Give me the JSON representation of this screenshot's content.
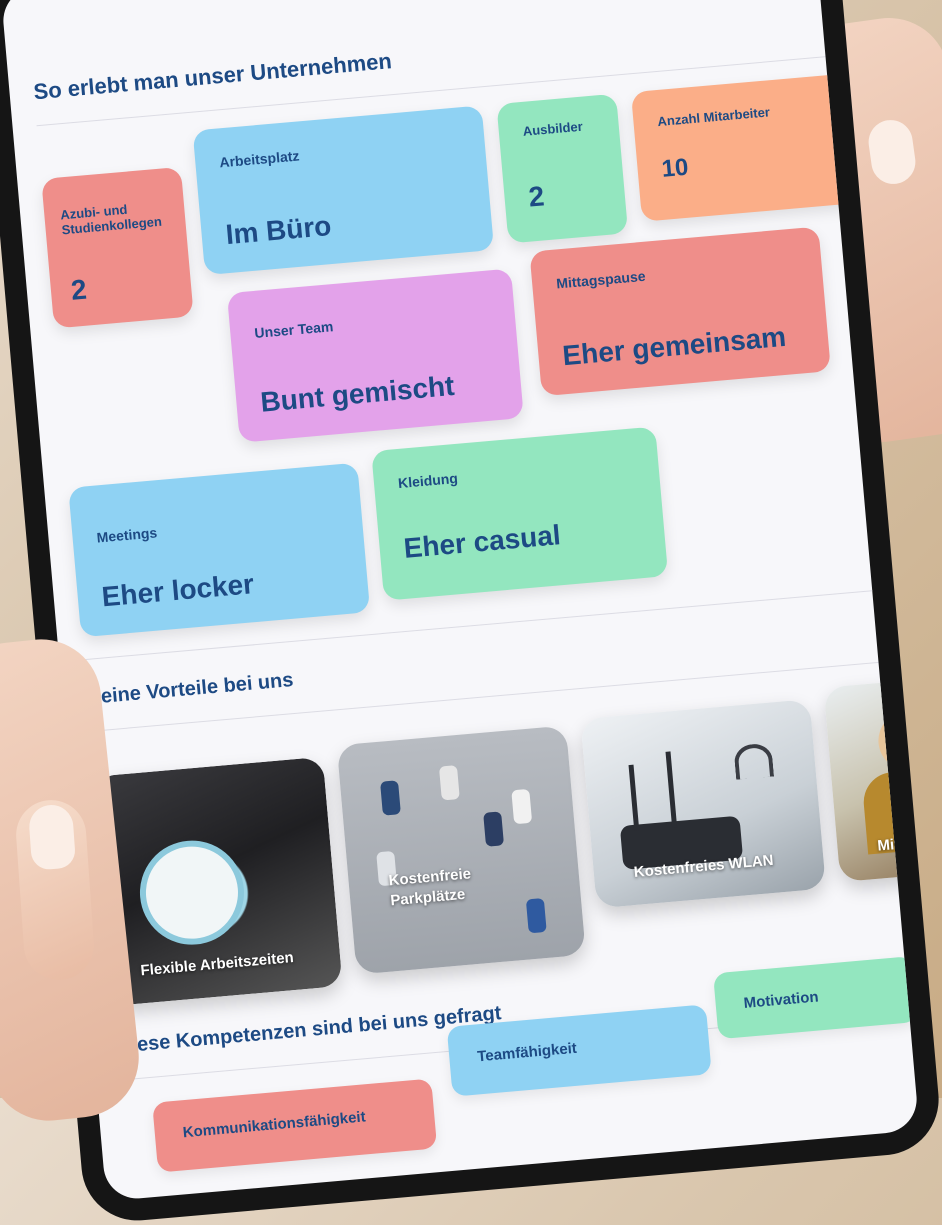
{
  "company_section": {
    "title": "So erlebt man unser Unternehmen",
    "tiles": [
      {
        "label": "Azubi- und Studienkollegen",
        "value": "2",
        "color": "#ef8e8a"
      },
      {
        "label": "Arbeitsplatz",
        "value": "Im Büro",
        "color": "#8fd2f3"
      },
      {
        "label": "Ausbilder",
        "value": "2",
        "color": "#93e6bf"
      },
      {
        "label": "Anzahl Mitarbeiter",
        "value": "10",
        "color": "#fbae88"
      },
      {
        "label": "Unser Team",
        "value": "Bunt gemischt",
        "color": "#e3a2ea"
      },
      {
        "label": "Mittagspause",
        "value": "Eher gemeinsam",
        "color": "#ef8e8a"
      },
      {
        "label": "Meetings",
        "value": "Eher locker",
        "color": "#8fd2f3"
      },
      {
        "label": "Kleidung",
        "value": "Eher casual",
        "color": "#93e6bf"
      }
    ]
  },
  "benefits_section": {
    "title": "Deine Vorteile bei uns",
    "items": [
      {
        "label": "Flexible Arbeitszeiten"
      },
      {
        "label": "Kostenfreie Parkplätze"
      },
      {
        "label": "Kostenfreies WLAN"
      },
      {
        "label": "Mitarbeiter"
      }
    ]
  },
  "skills_section": {
    "title": "Diese Kompetenzen sind bei uns gefragt",
    "chips": [
      {
        "label": "Motivation",
        "color": "#93e6bf"
      },
      {
        "label": "Teamfähigkeit",
        "color": "#8fd2f3"
      },
      {
        "label": "Kommunikationsfähigkeit",
        "color": "#ef8e8a"
      }
    ]
  },
  "accent_color": "#1d4a84"
}
